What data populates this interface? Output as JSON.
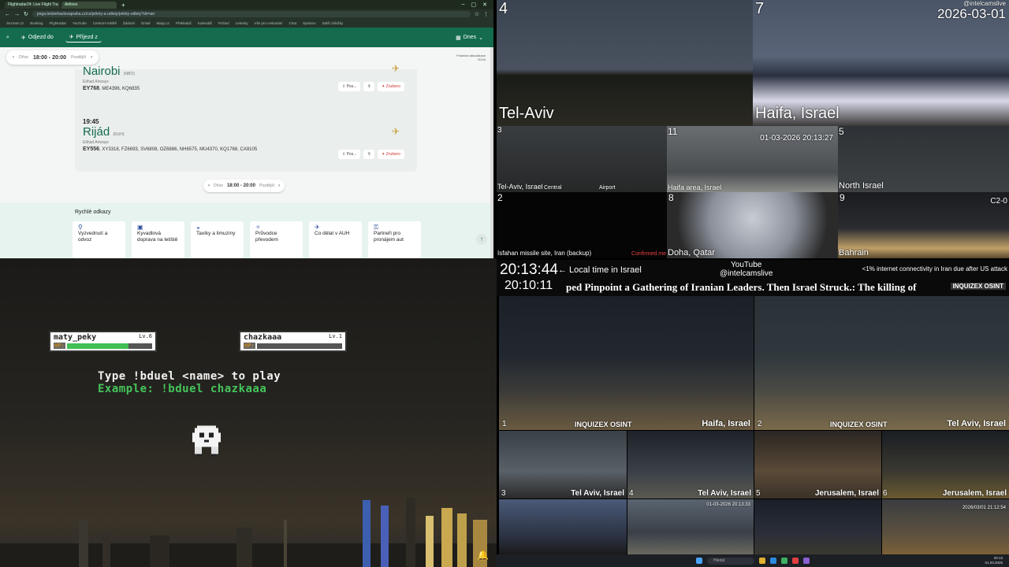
{
  "browser": {
    "tabs": [
      "Flightradar24: Live Flight Tra",
      "Airlines"
    ],
    "url": "pnga.letistehavlovapraha.cz/cs/prilety-a-odlety/prilety-odlety?dir=arr",
    "bookmarks": [
      "Seznam.cz",
      "Booking",
      "Flightradar",
      "YouTube",
      "Centrum letiště",
      "Žádosti",
      "Gmail",
      "Mapy.cz",
      "Překladač",
      "Kalendář",
      "Počasí",
      "Letenky",
      "Vše pro cestování",
      "Chat",
      "Správce",
      "Další záložky"
    ],
    "appbar": {
      "depart": "Odjezd do",
      "arrive": "Příjezd z",
      "date": "Dnes"
    },
    "timebar": {
      "prev": "Dříve",
      "range": "18:00 - 20:00",
      "next": "Pozdější"
    },
    "updated": [
      "Poslední aktualizace",
      "20:04"
    ],
    "flights": [
      {
        "time": "",
        "dest": "Nairobi",
        "iata": "(NBO)",
        "airline": "Etihad Airways",
        "code": "EY768",
        "codeshare": "ME4396, KQ6835",
        "share": "Pos...",
        "status": "Zrušeno"
      },
      {
        "time": "19:45",
        "dest": "Rijád",
        "iata": "(RUH)",
        "airline": "Etihad Airways",
        "code": "EY556",
        "codeshare": "XY3318, FZ6693, SV6808, OZ6886, NH6575, MU4370, KQ1768, CA9105",
        "share": "Pos...",
        "status": "Zrušeno"
      }
    ],
    "pager": {
      "prev": "Dříve",
      "range": "18:00 - 20:00",
      "next": "Pozdější"
    },
    "quick_title": "Rychlé odkazy",
    "quick_links": [
      "Vyzvednutí a odvoz",
      "Kyvadlová doprava na letiště",
      "Taxíky a limuzíny",
      "Průvodce převodem",
      "Co dělat v AUH",
      "Partneři pro pronájem aut"
    ]
  },
  "game": {
    "player1": {
      "name": "maty_peky",
      "level": "Lv.6",
      "hp_label": "HP:",
      "hp": 0.72
    },
    "player2": {
      "name": "chazkaaa",
      "level": "Lv.1",
      "hp_label": "HP:",
      "hp": 0
    },
    "line1": "Type !bduel <name> to play",
    "line2": "Example: !bduel chazkaaa"
  },
  "cams": {
    "top": [
      {
        "num": "4",
        "label": "Tel-Aviv"
      },
      {
        "num": "7",
        "label": "Haifa, Israel",
        "stamp": "2026-03-01",
        "handle": "@intelcamslive"
      },
      {
        "num": "3",
        "label": "Tel-Aviv, Israel",
        "sub1": "Central",
        "sub2": "Airport"
      },
      {
        "num": "11",
        "label": "Haifa area, Israel",
        "stamp": "01-03-2026 20:13:27"
      },
      {
        "num": "5",
        "label": "North Israel"
      },
      {
        "num": "2",
        "label": "Isfahan missile site, Iran (backup)",
        "stamp": "Confirmed me"
      },
      {
        "num": "8",
        "label": "Doha, Qatar"
      },
      {
        "num": "9",
        "label": "Bahrain",
        "stamp": "C2-0"
      }
    ],
    "info": {
      "clock1": "20:13:44",
      "local": "← Local time in Israel",
      "yt1": "YouTube",
      "yt2": "@intelcamslive",
      "iran": "<1% internet connectivity in Iran due after US attack",
      "clock2": "20:10:11",
      "ticker": "ped Pinpoint a Gathering of Iranian Leaders. Then Israel Struck.: The killing of",
      "osint": "INQUIZEX OSINT"
    },
    "bottom": [
      {
        "num": "1",
        "label": "Haifa, Israel",
        "brand": "INQUIZEX OSINT"
      },
      {
        "num": "2",
        "label": "Tel Aviv, Israel",
        "brand": "INQUIZEX OSINT"
      },
      {
        "num": "3",
        "label": "Tel Aviv, Israel"
      },
      {
        "num": "4",
        "label": "Tel Aviv, Israel"
      },
      {
        "num": "5",
        "label": "Jerusalem, Israel"
      },
      {
        "num": "6",
        "label": "Jerusalem, Israel"
      },
      {
        "num": "",
        "label": ""
      },
      {
        "num": "",
        "label": "",
        "stamp": "01-03-2026 20:13:33"
      },
      {
        "num": "",
        "label": ""
      },
      {
        "num": "",
        "label": "",
        "stamp": "2026/03/01 21:12:54"
      }
    ]
  },
  "taskbar": {
    "search": "Hledat",
    "time": "20:13",
    "date": "01.03.2026"
  }
}
